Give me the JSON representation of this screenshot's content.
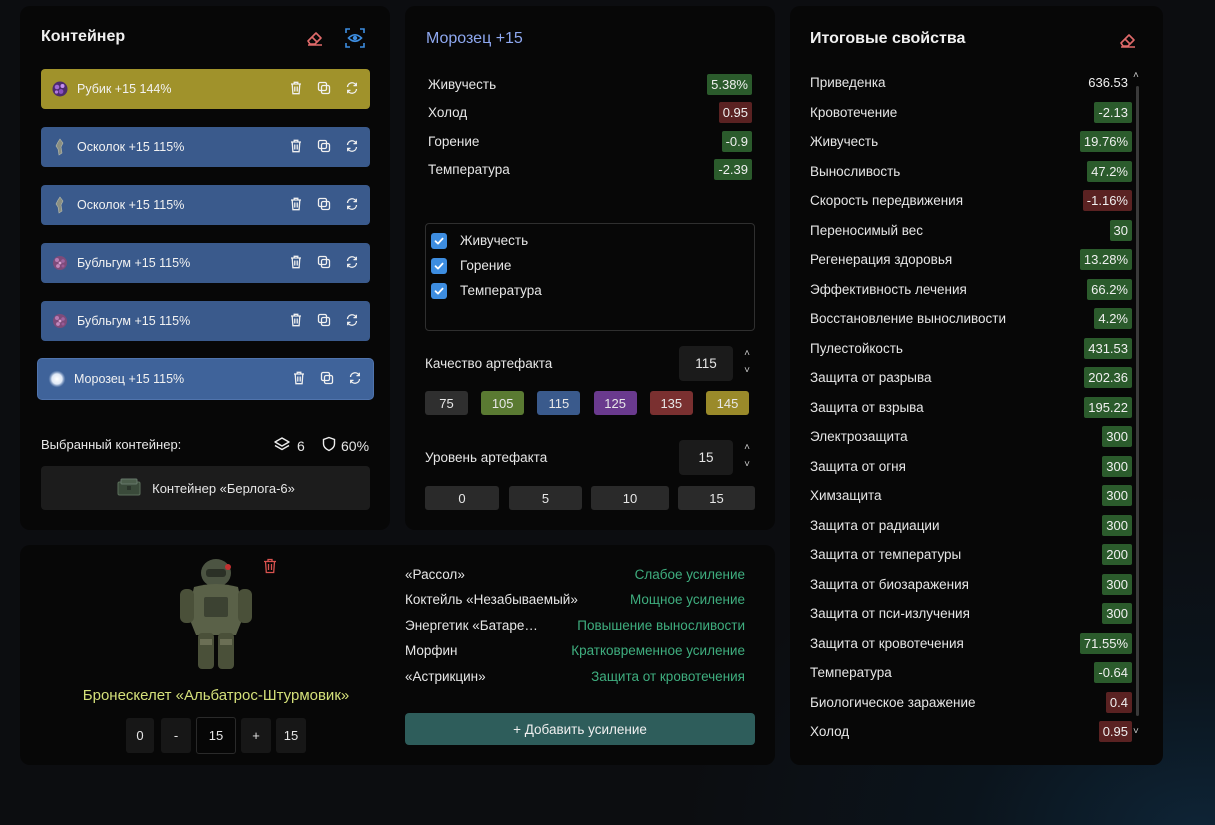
{
  "container": {
    "title": "Контейнер",
    "artifacts": [
      {
        "name": "Рубик +15 144%",
        "color": "yellow",
        "icon": "rubik-icon"
      },
      {
        "name": "Осколок +15 115%",
        "color": "blue",
        "icon": "shard-icon"
      },
      {
        "name": "Осколок +15 115%",
        "color": "blue",
        "icon": "shard-icon"
      },
      {
        "name": "Бубльгум +15 115%",
        "color": "blue",
        "icon": "bubblegum-icon"
      },
      {
        "name": "Бубльгум +15 115%",
        "color": "blue",
        "icon": "bubblegum-icon"
      },
      {
        "name": "Морозец +15 115%",
        "color": "blue-selected",
        "icon": "frost-icon"
      }
    ],
    "selected_label": "Выбранный контейнер:",
    "slots": "6",
    "protection": "60%",
    "container_name": "Контейнер «Берлога-6»"
  },
  "artifact": {
    "title": "Морозец +15",
    "stats": [
      {
        "name": "Живучесть",
        "value": "5.38%",
        "tone": "positive"
      },
      {
        "name": "Холод",
        "value": "0.95",
        "tone": "negative"
      },
      {
        "name": "Горение",
        "value": "-0.9",
        "tone": "positive"
      },
      {
        "name": "Температура",
        "value": "-2.39",
        "tone": "positive"
      }
    ],
    "checkboxes": [
      {
        "label": "Живучесть",
        "checked": true
      },
      {
        "label": "Горение",
        "checked": true
      },
      {
        "label": "Температура",
        "checked": true
      }
    ],
    "quality_label": "Качество артефакта",
    "quality_value": "115",
    "quality_presets": [
      "75",
      "105",
      "115",
      "125",
      "135",
      "145"
    ],
    "level_label": "Уровень артефакта",
    "level_value": "15",
    "level_presets": [
      "0",
      "5",
      "10",
      "15"
    ]
  },
  "armor": {
    "name": "Бронескелет «Альбатрос-Штурмовик»",
    "min": "0",
    "minus": "-",
    "value": "15",
    "plus": "+",
    "max": "15",
    "boosts": [
      {
        "item": "«Рассол»",
        "effect": "Слабое усиление"
      },
      {
        "item": "Коктейль «Незабываемый»",
        "effect": "Мощное усиление"
      },
      {
        "item": "Энергетик «Батаре…",
        "effect": "Повышение выносливости"
      },
      {
        "item": "Морфин",
        "effect": "Кратковременное усиление"
      },
      {
        "item": "«Астрикцин»",
        "effect": "Защита от кровотечения"
      }
    ],
    "add_boost": "+ Добавить усиление"
  },
  "totals": {
    "title": "Итоговые свойства",
    "stats": [
      {
        "name": "Приведенка",
        "value": "636.53",
        "tone": "neutral"
      },
      {
        "name": "Кровотечение",
        "value": "-2.13",
        "tone": "positive"
      },
      {
        "name": "Живучесть",
        "value": "19.76%",
        "tone": "positive"
      },
      {
        "name": "Выносливость",
        "value": "47.2%",
        "tone": "positive"
      },
      {
        "name": "Скорость передвижения",
        "value": "-1.16%",
        "tone": "negative"
      },
      {
        "name": "Переносимый вес",
        "value": "30",
        "tone": "positive"
      },
      {
        "name": "Регенерация здоровья",
        "value": "13.28%",
        "tone": "positive"
      },
      {
        "name": "Эффективность лечения",
        "value": "66.2%",
        "tone": "positive"
      },
      {
        "name": "Восстановление выносливости",
        "value": "4.2%",
        "tone": "positive"
      },
      {
        "name": "Пулестойкость",
        "value": "431.53",
        "tone": "positive"
      },
      {
        "name": "Защита от разрыва",
        "value": "202.36",
        "tone": "positive"
      },
      {
        "name": "Защита от взрыва",
        "value": "195.22",
        "tone": "positive"
      },
      {
        "name": "Электрозащита",
        "value": "300",
        "tone": "positive"
      },
      {
        "name": "Защита от огня",
        "value": "300",
        "tone": "positive"
      },
      {
        "name": "Химзащита",
        "value": "300",
        "tone": "positive"
      },
      {
        "name": "Защита от радиации",
        "value": "300",
        "tone": "positive"
      },
      {
        "name": "Защита от температуры",
        "value": "200",
        "tone": "positive"
      },
      {
        "name": "Защита от биозаражения",
        "value": "300",
        "tone": "positive"
      },
      {
        "name": "Защита от пси-излучения",
        "value": "300",
        "tone": "positive"
      },
      {
        "name": "Защита от кровотечения",
        "value": "71.55%",
        "tone": "positive"
      },
      {
        "name": "Температура",
        "value": "-0.64",
        "tone": "positive"
      },
      {
        "name": "Биологическое заражение",
        "value": "0.4",
        "tone": "negative"
      },
      {
        "name": "Холод",
        "value": "0.95",
        "tone": "negative"
      }
    ]
  },
  "colors": {
    "yellow": "#a0922b",
    "blue": "#3a5a8c",
    "positive_badge": "#2b5b2c",
    "negative_badge": "#5a2222",
    "accent_title": "#8ea8f0",
    "armor_name": "#d4e07a",
    "boost_effect": "#3fae7f"
  }
}
